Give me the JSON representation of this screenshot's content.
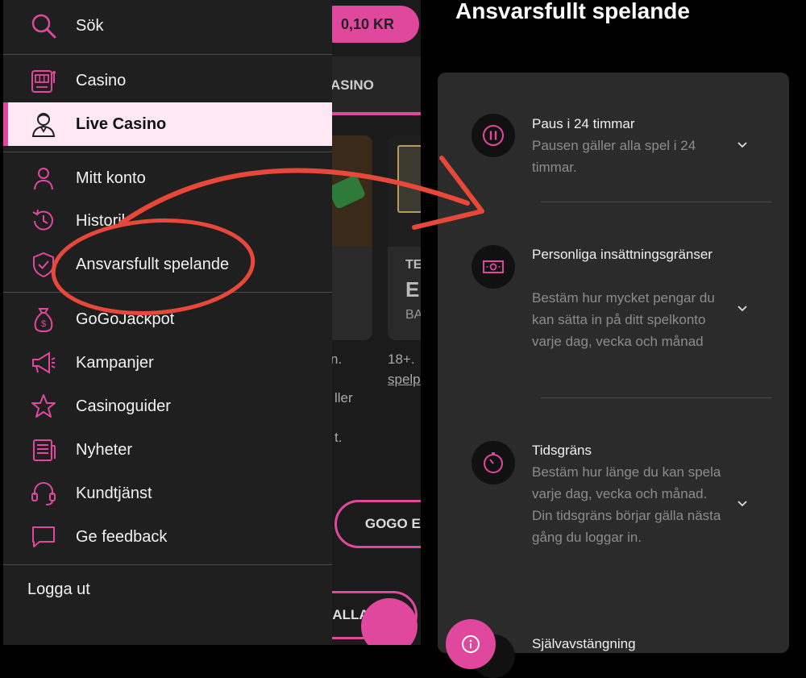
{
  "menu": {
    "search": "Sök",
    "casino": "Casino",
    "live_casino": "Live Casino",
    "account": "Mitt konto",
    "history": "Historik",
    "responsible": "Ansvarsfullt spelande",
    "jackpot": "GoGoJackpot",
    "campaigns": "Kampanjer",
    "guides": "Casinoguider",
    "news": "Nyheter",
    "support": "Kundtjänst",
    "feedback": "Ge feedback",
    "logout": "Logga ut"
  },
  "background_app": {
    "balance": "0,10 KR",
    "tab_label": "ASINO",
    "card_title_1": "TE",
    "card_title_2": "E",
    "card_title_3": "BA",
    "text_1": "n.",
    "text_2": "18+.",
    "text_3": "spelp",
    "text_4": "ller",
    "text_5": "t.",
    "button_1": "GOGO EX",
    "button_2": "ALLA"
  },
  "panel": {
    "title": "Ansvarsfullt spelande",
    "options": [
      {
        "title": "Paus i 24 timmar",
        "desc": "Pausen gäller alla spel i 24 timmar."
      },
      {
        "title": "Personliga insättningsgränser",
        "desc": "Bestäm hur mycket pengar du kan sätta in på ditt spelkonto varje dag, vecka och månad"
      },
      {
        "title": "Tidsgräns",
        "desc": "Bestäm hur länge du kan spela varje dag, vecka och månad. Din tidsgräns börjar gälla nästa gång du loggar in."
      },
      {
        "title": "Självavstängning",
        "desc": ""
      }
    ]
  },
  "colors": {
    "accent": "#e0489e",
    "annotation": "#e8483a"
  }
}
